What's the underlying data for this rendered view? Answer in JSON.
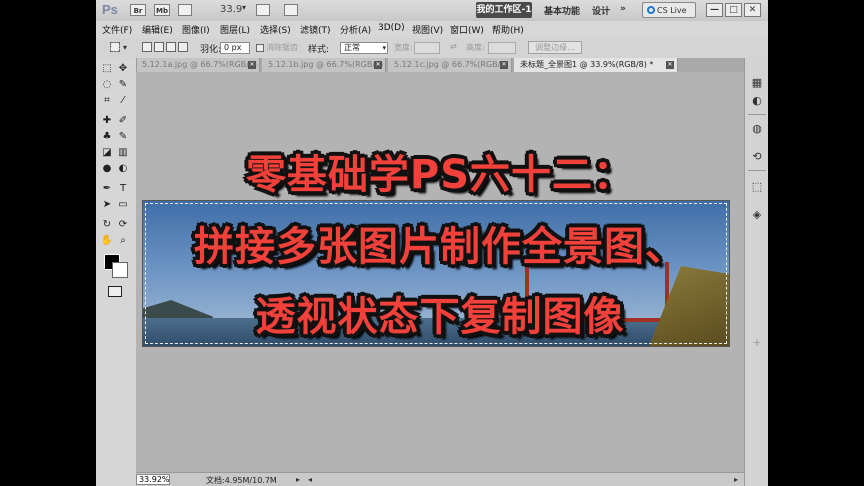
{
  "titlebar": {
    "logo": "Ps",
    "zoom_value": "33.9",
    "workspace_active": "我的工作区-1",
    "workspace_links": [
      "基本功能",
      "设计"
    ],
    "more": "»",
    "cs_live": "CS Live",
    "window_buttons": [
      "—",
      "□",
      "✕"
    ],
    "icons": [
      "Br",
      "Mb"
    ]
  },
  "menu": [
    "文件(F)",
    "编辑(E)",
    "图像(I)",
    "图层(L)",
    "选择(S)",
    "滤镜(T)",
    "分析(A)",
    "3D(D)",
    "视图(V)",
    "窗口(W)",
    "帮助(H)"
  ],
  "options": {
    "feather_label": "羽化:",
    "feather_value": "0 px",
    "antialias_label": "消除锯齿",
    "style_label": "样式:",
    "style_value": "正常",
    "width_label": "宽度:",
    "height_label": "高度:",
    "refine_button": "调整边缘..."
  },
  "tabs": [
    {
      "label": "5.12.1a.jpg @ 66.7%(RGB/8)",
      "active": false
    },
    {
      "label": "5.12.1b.jpg @ 66.7%(RGB/8)",
      "active": false
    },
    {
      "label": "5.12.1c.jpg @ 66.7%(RGB/8)",
      "active": false
    },
    {
      "label": "未标题_全景图1 @ 33.9%(RGB/8) *",
      "active": true
    }
  ],
  "tab_close": "✕",
  "overlay": {
    "line1": "零基础学PS六十二：",
    "line2": "拼接多张图片制作全景图、",
    "line3": "透视状态下复制图像"
  },
  "status": {
    "zoom": "33.92%",
    "doc": "文档:4.95M/10.7M"
  },
  "colors": {
    "headline": "#f2413a",
    "outline": "#111111",
    "workspace_bg": "#b3b3b3"
  }
}
